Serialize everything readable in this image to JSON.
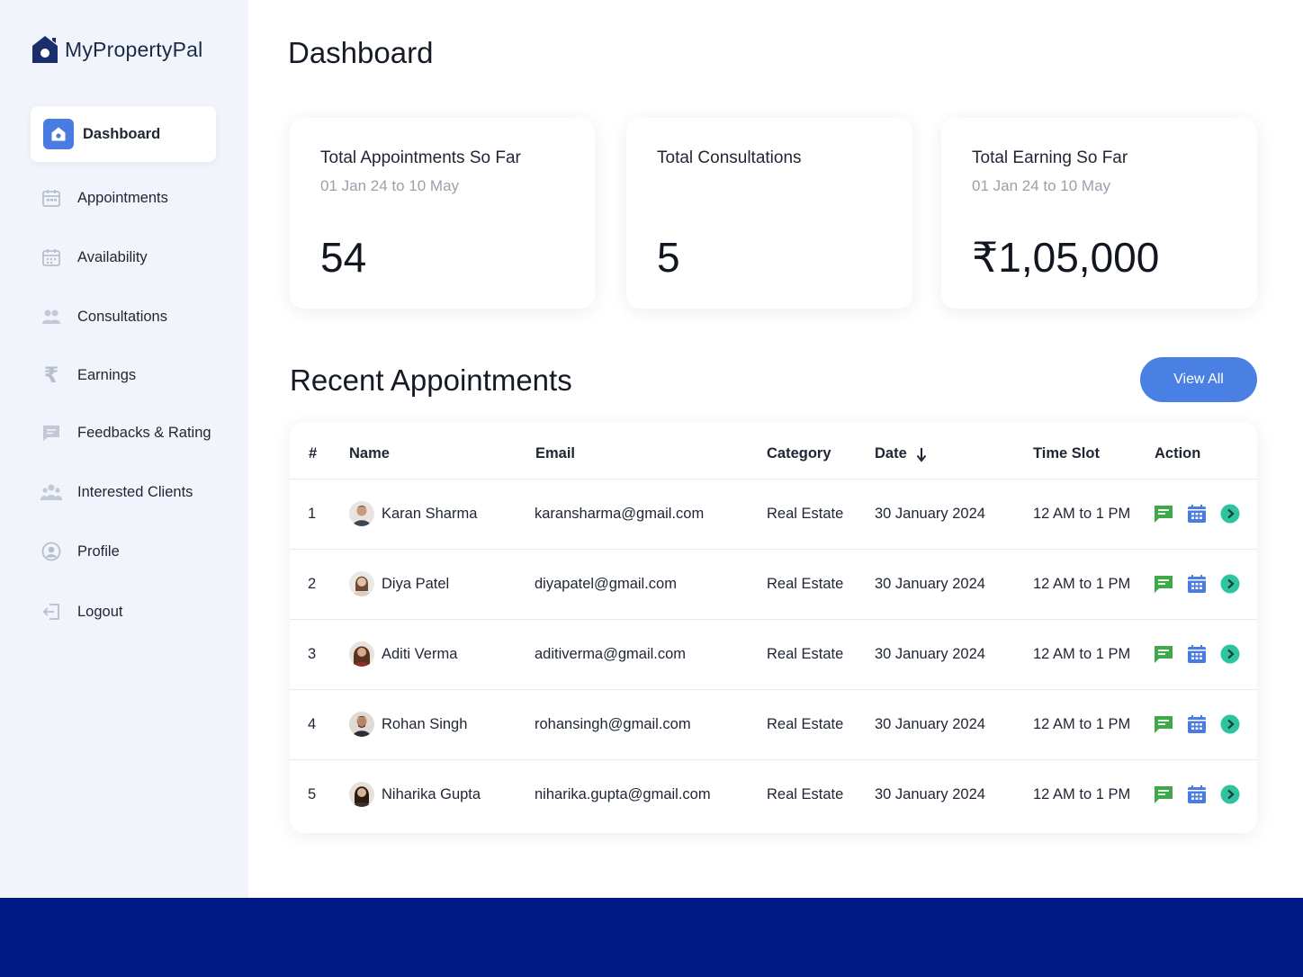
{
  "brand": {
    "name": "MyPropertyPal",
    "logo_icon": "house-icon",
    "color": "#1b2d6b"
  },
  "sidebar": {
    "items": [
      {
        "label": "Dashboard",
        "icon": "home-icon",
        "active": true
      },
      {
        "label": "Appointments",
        "icon": "calendar-icon"
      },
      {
        "label": "Availability",
        "icon": "calendar-grid-icon"
      },
      {
        "label": "Consultations",
        "icon": "people-icon"
      },
      {
        "label": "Earnings",
        "icon": "rupee-icon"
      },
      {
        "label": "Feedbacks & Rating",
        "icon": "message-icon"
      },
      {
        "label": "Interested Clients",
        "icon": "group-icon"
      },
      {
        "label": "Profile",
        "icon": "user-circle-icon"
      },
      {
        "label": "Logout",
        "icon": "logout-icon"
      }
    ]
  },
  "header": {
    "title": "Dashboard"
  },
  "stats": [
    {
      "title": "Total Appointments So Far",
      "subtitle": "01 Jan 24 to 10 May",
      "value": "54"
    },
    {
      "title": "Total Consultations",
      "subtitle": "",
      "value": "5"
    },
    {
      "title": "Total Earning So Far",
      "subtitle": "01 Jan 24 to 10 May",
      "value": "₹1,05,000"
    }
  ],
  "recent": {
    "title": "Recent Appointments",
    "view_all_label": "View All",
    "columns": [
      "#",
      "Name",
      "Email",
      "Category",
      "Date",
      "Time Slot",
      "Action"
    ],
    "sort_icon": "arrow-down-icon",
    "rows": [
      {
        "num": "1",
        "name": "Karan Sharma",
        "email": "karansharma@gmail.com",
        "category": "Real Estate",
        "date": "30 January 2024",
        "slot": "12 AM to 1 PM"
      },
      {
        "num": "2",
        "name": "Diya Patel",
        "email": "diyapatel@gmail.com",
        "category": "Real Estate",
        "date": "30 January 2024",
        "slot": "12 AM to 1 PM"
      },
      {
        "num": "3",
        "name": "Aditi Verma",
        "email": "aditiverma@gmail.com",
        "category": "Real Estate",
        "date": "30 January 2024",
        "slot": "12 AM to 1 PM"
      },
      {
        "num": "4",
        "name": "Rohan Singh",
        "email": "rohansingh@gmail.com",
        "category": "Real Estate",
        "date": "30 January 2024",
        "slot": "12 AM to 1 PM"
      },
      {
        "num": "5",
        "name": "Niharika Gupta",
        "email": "niharika.gupta@gmail.com",
        "category": "Real Estate",
        "date": "30 January 2024",
        "slot": "12 AM to 1 PM"
      }
    ],
    "actions": [
      {
        "icon": "chat-icon",
        "color": "#3fa84a"
      },
      {
        "icon": "calendar-icon",
        "color": "#4a7be0"
      },
      {
        "icon": "arrow-right-circle-icon",
        "color": "#2ec4a0"
      }
    ]
  },
  "colors": {
    "accent": "#4a80e4",
    "sidebar_bg": "#f1f4fa",
    "footer": "#001b87"
  }
}
